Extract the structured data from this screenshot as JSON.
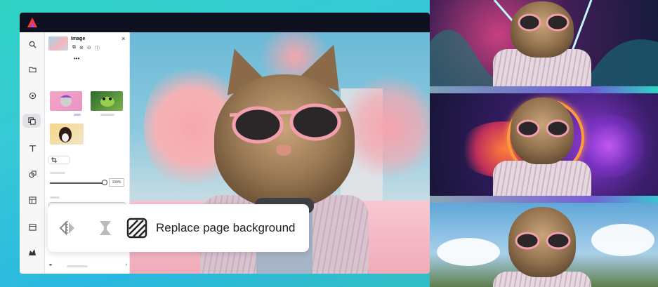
{
  "panel": {
    "title": "Image",
    "close": "×",
    "more": "•••",
    "zoom_value": "100%"
  },
  "action": {
    "label": "Replace page background"
  },
  "colors": {
    "brand_gradient": [
      "#2fd3c4",
      "#2ab7e0"
    ],
    "topbar": "#0f1120",
    "accent": "#ff0000"
  },
  "icons": {
    "logo": "adobe-express-logo",
    "rail": [
      "search-icon",
      "folder-icon",
      "brand-icon",
      "media-icon",
      "text-icon",
      "shapes-icon",
      "templates-icon",
      "calendar-icon",
      "plugins-icon"
    ],
    "pill": [
      "flip-icon",
      "remove-background-icon",
      "replace-background-icon"
    ]
  }
}
